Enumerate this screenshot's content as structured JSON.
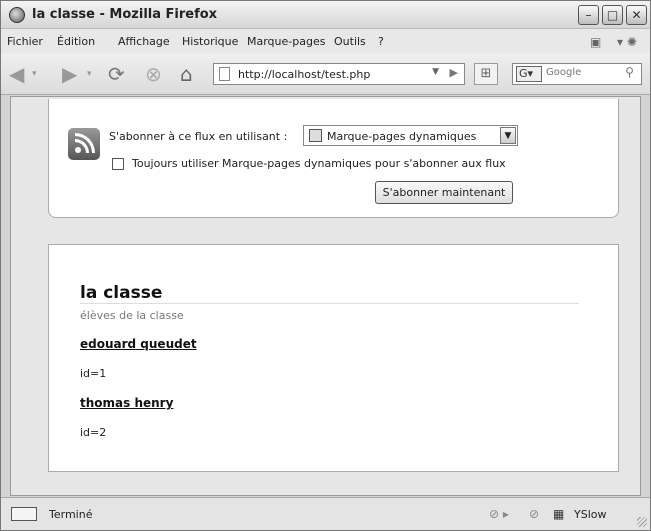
{
  "window": {
    "title": "la classe - Mozilla Firefox"
  },
  "menu": {
    "items": [
      "Fichier",
      "Édition",
      "Affichage",
      "Historique",
      "Marque-pages",
      "Outils",
      "?"
    ]
  },
  "navbar": {
    "url": "http://localhost/test.php",
    "search_placeholder": "Google",
    "search_engine": "G"
  },
  "feed": {
    "subscribe_label": "S'abonner à ce flux en utilisant :",
    "reader_selected": "Marque-pages dynamiques",
    "always_use_label": "Toujours utiliser Marque-pages dynamiques pour s'abonner aux flux",
    "always_use_checked": false,
    "subscribe_now_label": "S'abonner maintenant"
  },
  "page": {
    "title": "la classe",
    "subtitle": "élèves de la classe",
    "students": [
      {
        "name": "edouard queudet",
        "id_text": "id=1"
      },
      {
        "name": "thomas henry",
        "id_text": "id=2"
      }
    ]
  },
  "statusbar": {
    "text": "Terminé",
    "addon_label": "YSlow"
  }
}
